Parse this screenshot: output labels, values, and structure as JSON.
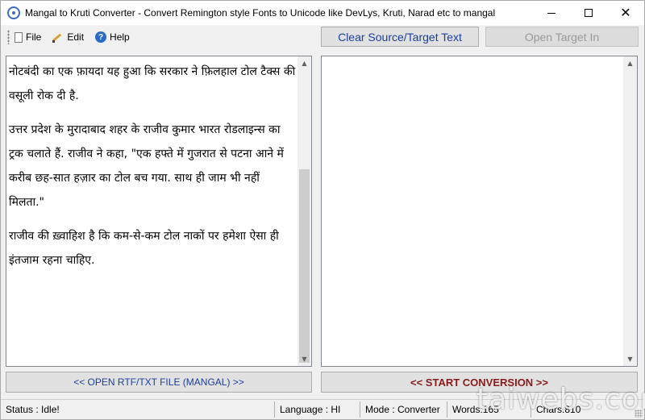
{
  "window": {
    "title": "Mangal to Kruti Converter - Convert Remington style Fonts to Unicode like DevLys, Kruti, Narad etc to mangal",
    "minimize_glyph": "",
    "close_glyph": "✕"
  },
  "menu": {
    "items": [
      {
        "label": "File",
        "icon": "file-icon"
      },
      {
        "label": "Edit",
        "icon": "edit-icon"
      },
      {
        "label": "Help",
        "icon": "help-icon"
      }
    ]
  },
  "toolbar": {
    "clear_label": "Clear Source/Target Text",
    "open_target_label": "Open Target In"
  },
  "source_text": {
    "paragraphs": [
      "नोटबंदी का एक फ़ायदा यह हुआ कि सरकार ने फ़िलहाल टोल टैक्स की वसूली रोक दी है.",
      "उत्तर प्रदेश के मुरादाबाद शहर के राजीव कुमार भारत रोडलाइन्स का ट्रक चलाते हैं. राजीव ने कहा, \"एक हफ्ते में गुजरात से पटना आने में करीब छह-सात हज़ार का टोल बच गया. साथ ही जाम भी नहीं मिलता.\"",
      "राजीव की ख़्वाहिश है कि कम-से-कम टोल नाकों पर हमेशा ऐसा ही इंतजाम रहना चाहिए."
    ]
  },
  "target_text": {
    "content": ""
  },
  "actions": {
    "open_rtf_label": "<< OPEN RTF/TXT FILE (MANGAL) >>",
    "start_label": "<< START CONVERSION >>"
  },
  "status": {
    "status": "Status :  Idle!",
    "language": "Language : HI",
    "mode": "Mode : Converter",
    "words": "Words:165",
    "chars": "Chars:810"
  },
  "watermark": "taiwebs.com"
}
